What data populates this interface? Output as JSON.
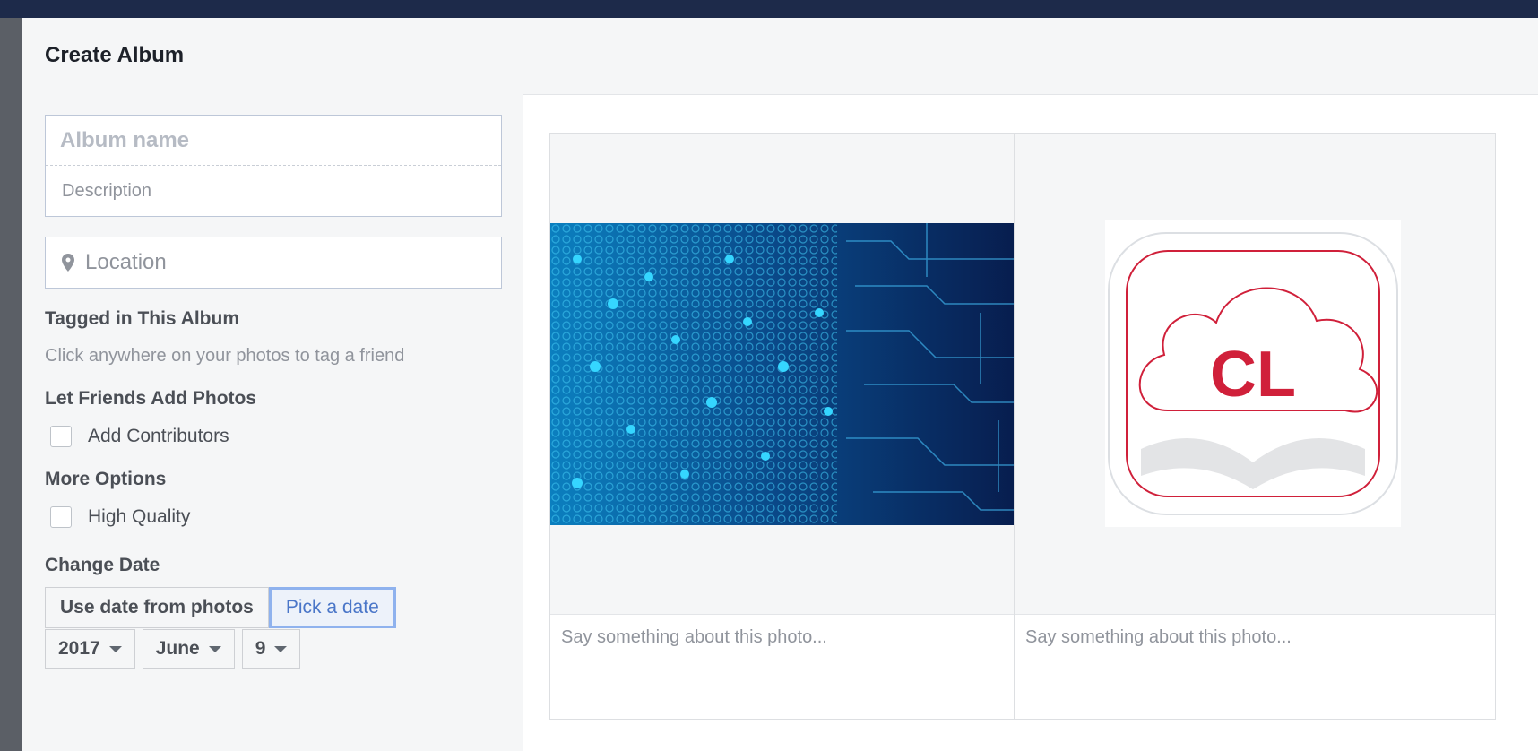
{
  "dialog": {
    "title": "Create Album"
  },
  "form": {
    "album_name_placeholder": "Album name",
    "description_placeholder": "Description",
    "location_placeholder": "Location",
    "tagged_title": "Tagged in This Album",
    "tagged_hint": "Click anywhere on your photos to tag a friend",
    "friends_title": "Let Friends Add Photos",
    "contributors_label": "Add Contributors",
    "contributors_checked": false,
    "more_title": "More Options",
    "high_quality_label": "High Quality",
    "high_quality_checked": false,
    "date_title": "Change Date",
    "use_date_label": "Use date from photos",
    "pick_date_label": "Pick a date",
    "year": "2017",
    "month": "June",
    "day": "9"
  },
  "photos": [
    {
      "image": "circuit-board-photo",
      "caption_placeholder": "Say something about this photo..."
    },
    {
      "image": "cl-cloud-book-logo",
      "logo_text": "CL",
      "caption_placeholder": "Say something about this photo..."
    }
  ],
  "colors": {
    "accent": "#4a76c8",
    "logo_red": "#d0203a",
    "page_bg": "#1d2a4a"
  }
}
